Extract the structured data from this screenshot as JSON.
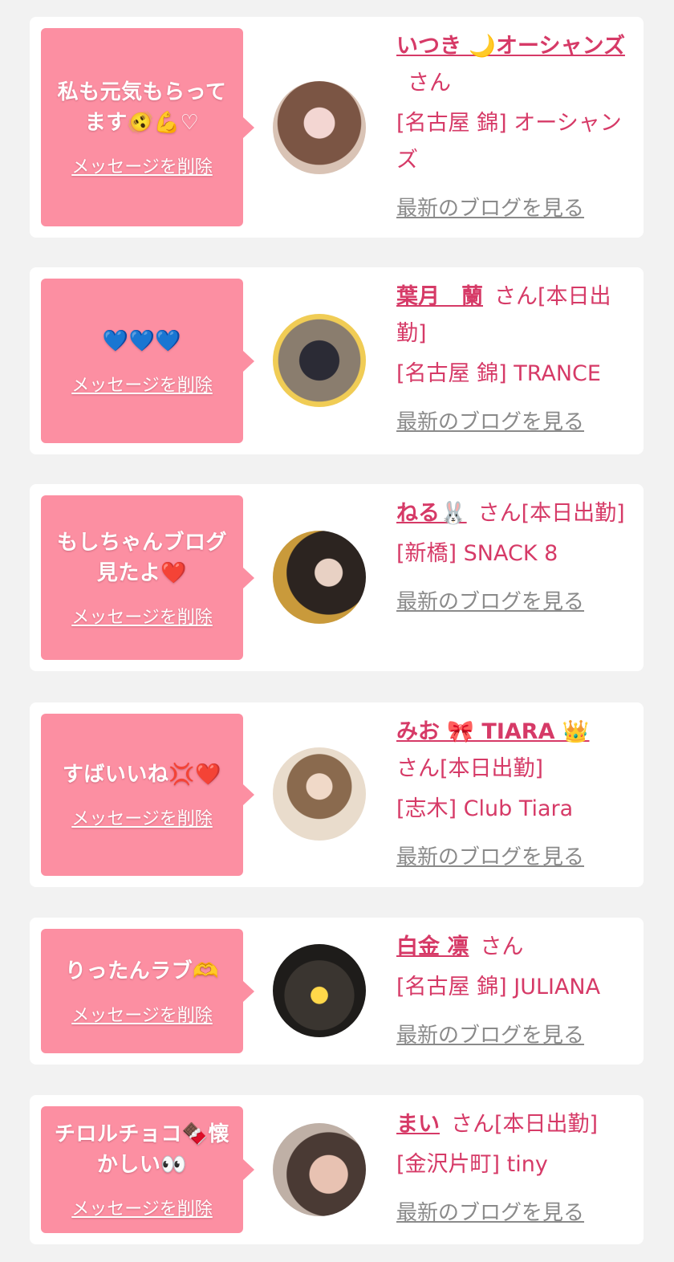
{
  "cards": [
    {
      "message": "私も元気もらってます🫨💪♡",
      "delete_label": "メッセージを削除",
      "name": "いつき 🌙オーシャンズ",
      "san": "さん",
      "shop": "[名古屋 錦] オーシャンズ",
      "blog_label": "最新のブログを見る"
    },
    {
      "message": "💙💙💙",
      "delete_label": "メッセージを削除",
      "name": "葉月　蘭",
      "san": "さん[本日出勤]",
      "shop": "[名古屋 錦] TRANCE",
      "blog_label": "最新のブログを見る"
    },
    {
      "message": "もしちゃんブログ見たよ❤️",
      "delete_label": "メッセージを削除",
      "name": "ねる🐰",
      "san": "さん[本日出勤]",
      "shop": "[新橋] SNACK 8",
      "blog_label": "最新のブログを見る"
    },
    {
      "message": "すばいいね💢❤️",
      "delete_label": "メッセージを削除",
      "name": "みお 🎀 TIARA 👑",
      "san": "さん[本日出勤]",
      "shop": "[志木] Club Tiara",
      "blog_label": "最新のブログを見る"
    },
    {
      "message": "りったんラブ🫶",
      "delete_label": "メッセージを削除",
      "name": "白金 凛",
      "san": "さん",
      "shop": "[名古屋 錦] JULIANA",
      "blog_label": "最新のブログを見る"
    },
    {
      "message": "チロルチョコ🍫懐かしい👀",
      "delete_label": "メッセージを削除",
      "name": "まい",
      "san": "さん[本日出勤]",
      "shop": "[金沢片町] tiny",
      "blog_label": "最新のブログを見る"
    }
  ],
  "colors": {
    "bubble": "#fc8fa2",
    "name": "#d63a67",
    "blog_link": "#8a8a8a",
    "background": "#f2f2f2"
  }
}
